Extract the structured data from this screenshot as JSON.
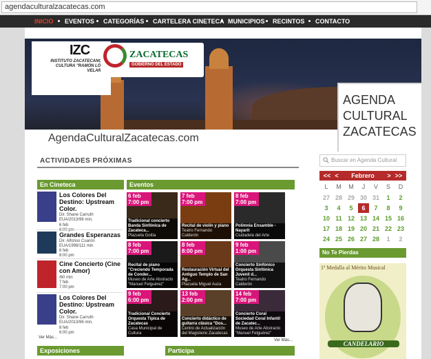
{
  "browser": {
    "url": "agendaculturalzacatecas.com"
  },
  "nav": {
    "items": [
      "INICIO",
      "EVENTOS",
      "CATEGORÍAS",
      "CARTELERA CINETECA",
      "MUNICIPIOS",
      "RECINTOS",
      "CONTACTO"
    ],
    "active": "INICIO",
    "active_color": "#e0402a"
  },
  "banner": {
    "izc_letters": "IZC",
    "izc_text": "INSTITUTO ZACATECANO DE CULTURA \"RAMÓN LÓPEZ VELARDE\"",
    "zac_title": "ZACATECAS",
    "zac_sub": "GOBIERNO DEL ESTADO",
    "site_url": "AgendaCulturalZacatecas.com",
    "agenda_lines": [
      "AGENDA",
      "CULTURAL",
      "ZACATECAS"
    ]
  },
  "section": {
    "title": "ACTIVIDADES PRÓXIMAS"
  },
  "cineteca": {
    "heading": "En Cineteca",
    "items": [
      {
        "title": "Los Colores Del Destino: Upstream Color.",
        "director": "Dir. Shane Carruth",
        "info": "EUA/2013/96 min.",
        "date": "6 feb",
        "time": "6:00 pm",
        "thumb_color": "#3a3f8a"
      },
      {
        "title": "Grandes Esperanzas",
        "director": "Dir. Alfonso Cuarón",
        "info": "EUA/1998/111 min",
        "date": "6 feb",
        "time": "8:00 pm",
        "thumb_color": "#1d3a5a"
      },
      {
        "title": "Cine Concierto (Cine con Amor)",
        "director": "",
        "info": "/60 min",
        "date": "7 feb",
        "time": "7:00 pm",
        "thumb_color": "#c0242b"
      },
      {
        "title": "Los Colores Del Destino: Upstream Color.",
        "director": "Dir. Shane Carruth",
        "info": "EUA/2013/96 min.",
        "date": "8 feb",
        "time": "6:00 pm",
        "thumb_color": "#3a3f8a"
      }
    ],
    "more": "Ver Más..."
  },
  "eventos": {
    "heading": "Eventos",
    "items": [
      {
        "date": "6 feb",
        "time": "7:00 pm",
        "title": "Tradicional concierto Banda Sinfónica de Zacateca...",
        "place": "Plazuela Goitia",
        "bg": "#3a2a1a"
      },
      {
        "date": "7 feb",
        "time": "7:00 pm",
        "title": "Recital de violín y piano",
        "place": "Teatro Fernando Calderón",
        "bg": "#7a3d12"
      },
      {
        "date": "8 feb",
        "time": "7:00 pm",
        "title": "Polimnia Ensamble - Nayarit",
        "place": "Ciudadela del Arte",
        "bg": "#2a2a2a"
      },
      {
        "date": "8 feb",
        "time": "7:00 pm",
        "title": "Recital de piano \"Creciendo Temporada de Conder...",
        "place": "Museo de Arte Abstracto \"Manuel Felguérez\"",
        "bg": "#1a1a1a"
      },
      {
        "date": "8 feb",
        "time": "8:00 pm",
        "title": "Restauración Virtual del Antiguo Templo de San Ag...",
        "place": "Plazuela Miguel Auza",
        "bg": "#6a3a1a"
      },
      {
        "date": "9 feb",
        "time": "1:00 pm",
        "title": "Concierto Sinfónico Orquesta Sinfónica Juvenil d...",
        "place": "Teatro Fernando Calderón",
        "bg": "#4a4a4a"
      },
      {
        "date": "9 feb",
        "time": "6:00 pm",
        "title": "Tradicional Concierto Orquesta Típica de Zacatecas",
        "place": "Casa Municipal de Cultura",
        "bg": "#2a1a1a"
      },
      {
        "date": "13 feb",
        "time": "2:00 pm",
        "title": "Concierto didáctico de guitarra clásica \"Dos...",
        "place": "Centro de Actualización del Magisterio Zacatecas",
        "bg": "#5a4028"
      },
      {
        "date": "14 feb",
        "time": "7:00 pm",
        "title": "Concierto Coral Sociedad Coral Infantil de Zacatec...",
        "place": "Museo de Arte Abstracto \"Manuel Felguérez\"",
        "bg": "#3a2a3a"
      }
    ],
    "more": "Ver Más..."
  },
  "bottom": {
    "exposiciones": "Exposiciones",
    "participa": "Participa"
  },
  "sidebar": {
    "search_placeholder": "Buscar en Agenda Cultural",
    "calendar": {
      "prev2": "<<",
      "prev": "<",
      "month": "Febrero",
      "next": ">",
      "next2": ">>",
      "dow": [
        "L",
        "M",
        "M",
        "J",
        "V",
        "S",
        "D"
      ],
      "weeks": [
        [
          "27",
          "28",
          "29",
          "30",
          "31",
          "1",
          "2"
        ],
        [
          "3",
          "4",
          "5",
          "6",
          "7",
          "8",
          "9"
        ],
        [
          "10",
          "11",
          "12",
          "13",
          "14",
          "15",
          "16"
        ],
        [
          "17",
          "18",
          "19",
          "20",
          "21",
          "22",
          "23"
        ],
        [
          "24",
          "25",
          "26",
          "27",
          "28",
          "1",
          "2"
        ]
      ],
      "today": "6",
      "accent": "#b52a2a",
      "event_color": "#5a9b2a"
    },
    "no_te_pierdas": "No Te Pierdas",
    "promo": {
      "title": "1ª Medalla al Mérito Musical",
      "name": "CANDELARIO"
    }
  }
}
